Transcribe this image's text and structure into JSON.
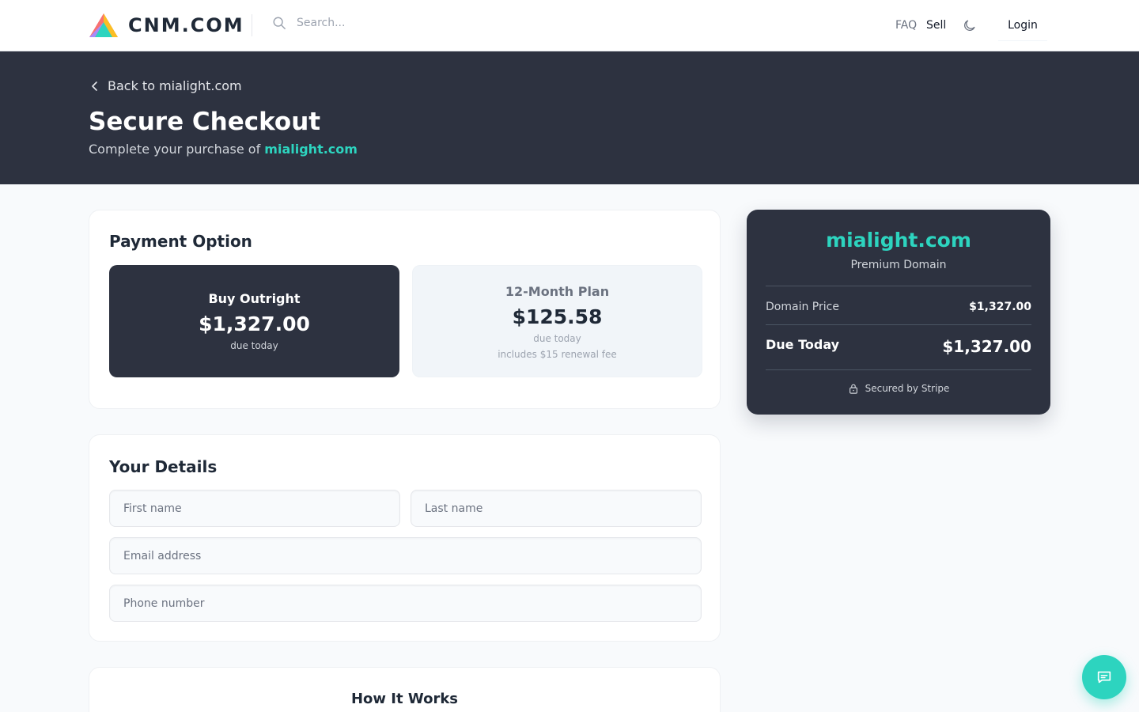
{
  "brand": {
    "name": "CNM.COM"
  },
  "search": {
    "placeholder": "Search..."
  },
  "nav": {
    "faq": "FAQ",
    "sell": "Sell",
    "login": "Login"
  },
  "hero": {
    "back_link": "Back to mialight.com",
    "title": "Secure Checkout",
    "subtitle_prefix": "Complete your purchase of ",
    "domain": "mialight.com"
  },
  "payment": {
    "title": "Payment Option",
    "outright": {
      "name": "Buy Outright",
      "price": "$1,327.00",
      "note": "due today"
    },
    "plan": {
      "name": "12-Month Plan",
      "price": "$125.58",
      "note": "due today",
      "note2": "includes $15 renewal fee"
    }
  },
  "details": {
    "title": "Your Details",
    "first_name_placeholder": "First name",
    "last_name_placeholder": "Last name",
    "email_placeholder": "Email address",
    "phone_placeholder": "Phone number"
  },
  "how": {
    "title": "How It Works"
  },
  "summary": {
    "domain": "mialight.com",
    "tag": "Premium Domain",
    "price_label": "Domain Price",
    "price_value": "$1,327.00",
    "due_label": "Due Today",
    "due_value": "$1,327.00",
    "secured": "Secured by Stripe"
  },
  "colors": {
    "accent": "#2dd4bf",
    "dark": "#2d3240"
  },
  "icons": [
    "logo-icon",
    "search-icon",
    "moon-icon",
    "chevron-left-icon",
    "lock-icon",
    "chat-icon"
  ]
}
